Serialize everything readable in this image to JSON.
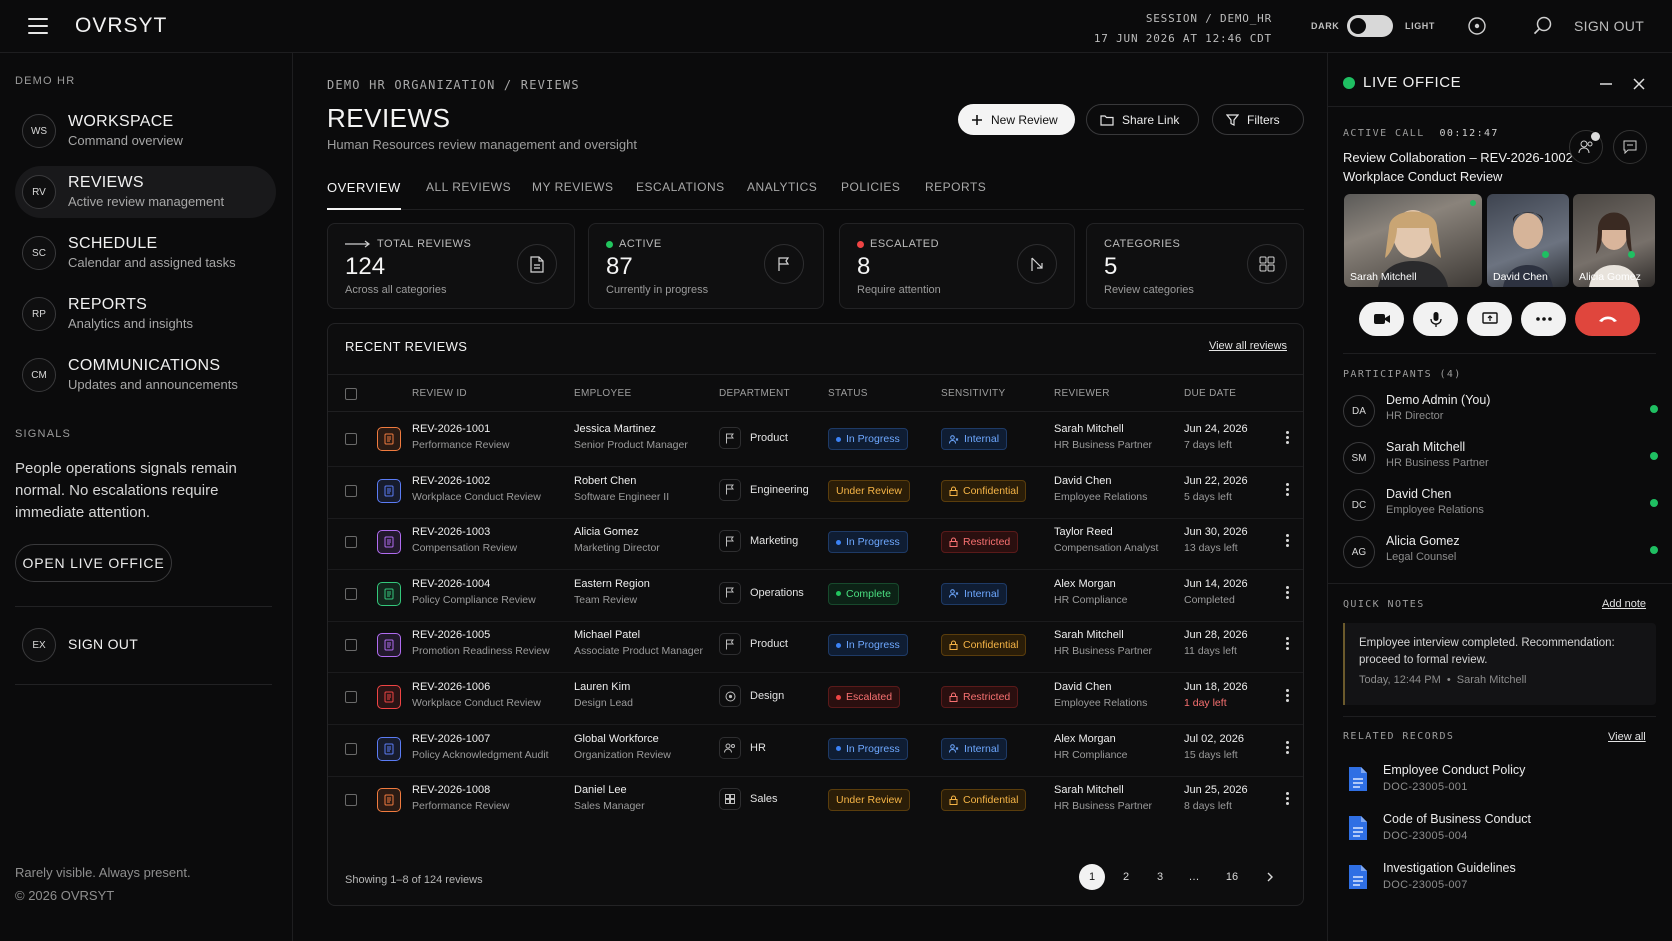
{
  "app": {
    "logo": "OVRSYT"
  },
  "topbar": {
    "session": "SESSION / DEMO_HR",
    "datetime": "17 JUN 2026 AT 12:46 CDT",
    "dark_label": "DARK",
    "light_label": "LIGHT",
    "sign_out": "SIGN OUT"
  },
  "sidebar": {
    "org_label": "DEMO HR",
    "items": [
      {
        "badge": "WS",
        "title": "WORKSPACE",
        "sub": "Command overview"
      },
      {
        "badge": "RV",
        "title": "REVIEWS",
        "sub": "Active review management"
      },
      {
        "badge": "SC",
        "title": "SCHEDULE",
        "sub": "Calendar and assigned tasks"
      },
      {
        "badge": "RP",
        "title": "REPORTS",
        "sub": "Analytics and insights"
      },
      {
        "badge": "CM",
        "title": "COMMUNICATIONS",
        "sub": "Updates and announcements"
      }
    ],
    "signals_label": "SIGNALS",
    "signals_text": "People operations signals remain normal. No escalations require immediate attention.",
    "live_office_button": "OPEN LIVE OFFICE",
    "signout": {
      "badge": "EX",
      "title": "SIGN OUT"
    },
    "tagline": "Rarely visible. Always present.",
    "copyright": "© 2026 OVRSYT"
  },
  "main": {
    "breadcrumb": "DEMO HR ORGANIZATION / REVIEWS",
    "title": "REVIEWS",
    "subtitle": "Human Resources review management and oversight",
    "buttons": {
      "new_review": "New Review",
      "share_link": "Share Link",
      "filters": "Filters"
    },
    "tabs": [
      "OVERVIEW",
      "ALL REVIEWS",
      "MY REVIEWS",
      "ESCALATIONS",
      "ANALYTICS",
      "POLICIES",
      "REPORTS"
    ],
    "stats": [
      {
        "label": "TOTAL REVIEWS",
        "value": "124",
        "sub": "Across all categories"
      },
      {
        "label": "ACTIVE",
        "value": "87",
        "sub": "Currently in progress"
      },
      {
        "label": "ESCALATED",
        "value": "8",
        "sub": "Require attention"
      },
      {
        "label": "CATEGORIES",
        "value": "5",
        "sub": "Review categories"
      }
    ],
    "recent": {
      "title": "RECENT REVIEWS",
      "view_all": "View all reviews",
      "columns": [
        "REVIEW ID",
        "EMPLOYEE",
        "DEPARTMENT",
        "STATUS",
        "SENSITIVITY",
        "REVIEWER",
        "DUE DATE"
      ],
      "rows": [
        {
          "id": "REV-2026-1001",
          "type": "Performance Review",
          "employee": "Jessica Martinez",
          "role": "Senior Product Manager",
          "dept": "Product",
          "status": "In Progress",
          "sensitivity": "Internal",
          "reviewer": "Sarah Mitchell",
          "reviewer_role": "HR Business Partner",
          "due": "Jun 24, 2026",
          "due_note": "7 days left"
        },
        {
          "id": "REV-2026-1002",
          "type": "Workplace Conduct Review",
          "employee": "Robert Chen",
          "role": "Software Engineer II",
          "dept": "Engineering",
          "status": "Under Review",
          "sensitivity": "Confidential",
          "reviewer": "David Chen",
          "reviewer_role": "Employee Relations",
          "due": "Jun 22, 2026",
          "due_note": "5 days left"
        },
        {
          "id": "REV-2026-1003",
          "type": "Compensation Review",
          "employee": "Alicia Gomez",
          "role": "Marketing Director",
          "dept": "Marketing",
          "status": "In Progress",
          "sensitivity": "Restricted",
          "reviewer": "Taylor Reed",
          "reviewer_role": "Compensation Analyst",
          "due": "Jun 30, 2026",
          "due_note": "13 days left"
        },
        {
          "id": "REV-2026-1004",
          "type": "Policy Compliance Review",
          "employee": "Eastern Region",
          "role": "Team Review",
          "dept": "Operations",
          "status": "Complete",
          "sensitivity": "Internal",
          "reviewer": "Alex Morgan",
          "reviewer_role": "HR Compliance",
          "due": "Jun 14, 2026",
          "due_note": "Completed"
        },
        {
          "id": "REV-2026-1005",
          "type": "Promotion Readiness Review",
          "employee": "Michael Patel",
          "role": "Associate Product Manager",
          "dept": "Product",
          "status": "In Progress",
          "sensitivity": "Confidential",
          "reviewer": "Sarah Mitchell",
          "reviewer_role": "HR Business Partner",
          "due": "Jun 28, 2026",
          "due_note": "11 days left"
        },
        {
          "id": "REV-2026-1006",
          "type": "Workplace Conduct Review",
          "employee": "Lauren Kim",
          "role": "Design Lead",
          "dept": "Design",
          "status": "Escalated",
          "sensitivity": "Restricted",
          "reviewer": "David Chen",
          "reviewer_role": "Employee Relations",
          "due": "Jun 18, 2026",
          "due_note": "1 day left"
        },
        {
          "id": "REV-2026-1007",
          "type": "Policy Acknowledgment Audit",
          "employee": "Global Workforce",
          "role": "Organization Review",
          "dept": "HR",
          "status": "In Progress",
          "sensitivity": "Internal",
          "reviewer": "Alex Morgan",
          "reviewer_role": "HR Compliance",
          "due": "Jul 02, 2026",
          "due_note": "15 days left"
        },
        {
          "id": "REV-2026-1008",
          "type": "Performance Review",
          "employee": "Daniel Lee",
          "role": "Sales Manager",
          "dept": "Sales",
          "status": "Under Review",
          "sensitivity": "Confidential",
          "reviewer": "Sarah Mitchell",
          "reviewer_role": "HR Business Partner",
          "due": "Jun 25, 2026",
          "due_note": "8 days left"
        }
      ],
      "showing": "Showing 1–8 of 124 reviews",
      "pages": [
        "1",
        "2",
        "3",
        "…",
        "16"
      ]
    }
  },
  "live_office": {
    "title": "LIVE OFFICE",
    "active_call_label": "ACTIVE CALL",
    "timer": "00:12:47",
    "call_title": "Review Collaboration – REV-2026-1002",
    "call_subtitle": "Workplace Conduct Review",
    "tiles": [
      "Sarah Mitchell",
      "David Chen",
      "Alicia Gomez"
    ],
    "participants_label": "PARTICIPANTS (4)",
    "participants": [
      {
        "initials": "DA",
        "name": "Demo Admin (You)",
        "role": "HR Director"
      },
      {
        "initials": "SM",
        "name": "Sarah Mitchell",
        "role": "HR Business Partner"
      },
      {
        "initials": "DC",
        "name": "David Chen",
        "role": "Employee Relations"
      },
      {
        "initials": "AG",
        "name": "Alicia Gomez",
        "role": "Legal Counsel"
      }
    ],
    "quick_notes_label": "QUICK NOTES",
    "add_note": "Add note",
    "note_text": "Employee interview completed. Recommendation: proceed to formal review.",
    "note_meta": "Today, 12:44 PM  •  Sarah Mitchell",
    "related_label": "RELATED RECORDS",
    "view_all": "View all",
    "records": [
      {
        "title": "Employee Conduct Policy",
        "code": "DOC-23005-001"
      },
      {
        "title": "Code of Business Conduct",
        "code": "DOC-23005-004"
      },
      {
        "title": "Investigation Guidelines",
        "code": "DOC-23005-007"
      }
    ]
  },
  "colors": {
    "in_progress": "#3b82f6",
    "under_review": "#f59e0b",
    "complete": "#22c55e",
    "escalated": "#ef4444",
    "internal": "#60a5fa",
    "confidential": "#f59e0b",
    "restricted": "#ef4444",
    "online": "#1fbf62",
    "hangup": "#e0463d"
  }
}
